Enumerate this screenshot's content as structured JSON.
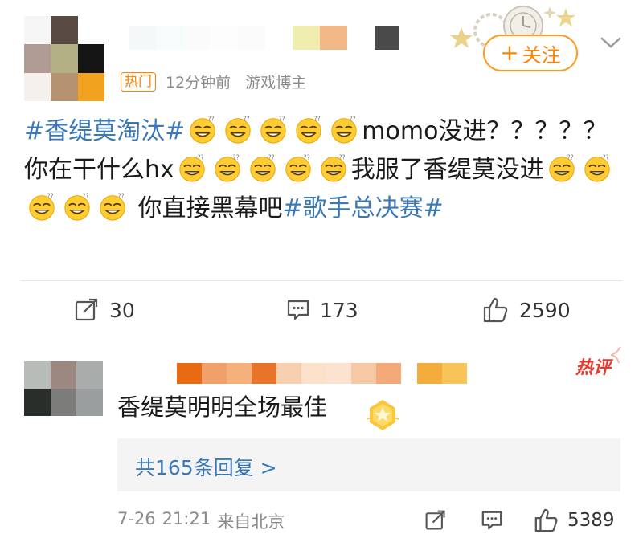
{
  "post": {
    "hot_badge": "热门",
    "time": "12分钟前",
    "source": "游戏博主",
    "follow_label": "关注",
    "body": {
      "topic1": "#香缇莫淘汰#",
      "text1": "momo没进？？？？？你在干什么hx",
      "text2": "我服了香缇莫没进",
      "text3": " 你直接黑幕吧",
      "topic2": "#歌手总决赛#"
    },
    "actions": {
      "repost": "30",
      "comments": "173",
      "likes": "2590"
    }
  },
  "comment": {
    "hot_label": "热评",
    "text": "香缇莫明明全场最佳",
    "replies_label": "共165条回复 >",
    "date": "7-26",
    "time": "21:21",
    "location": "来自北京",
    "likes": "5389"
  },
  "colors": {
    "accent_orange": "#ff8200",
    "link_blue": "#3a78b8",
    "hot_red": "#e8372c"
  },
  "icons": [
    "gear-decoration-icon",
    "chevron-down-icon",
    "emoji-grin-icon",
    "repost-icon",
    "comment-icon",
    "like-icon",
    "medal-icon"
  ]
}
